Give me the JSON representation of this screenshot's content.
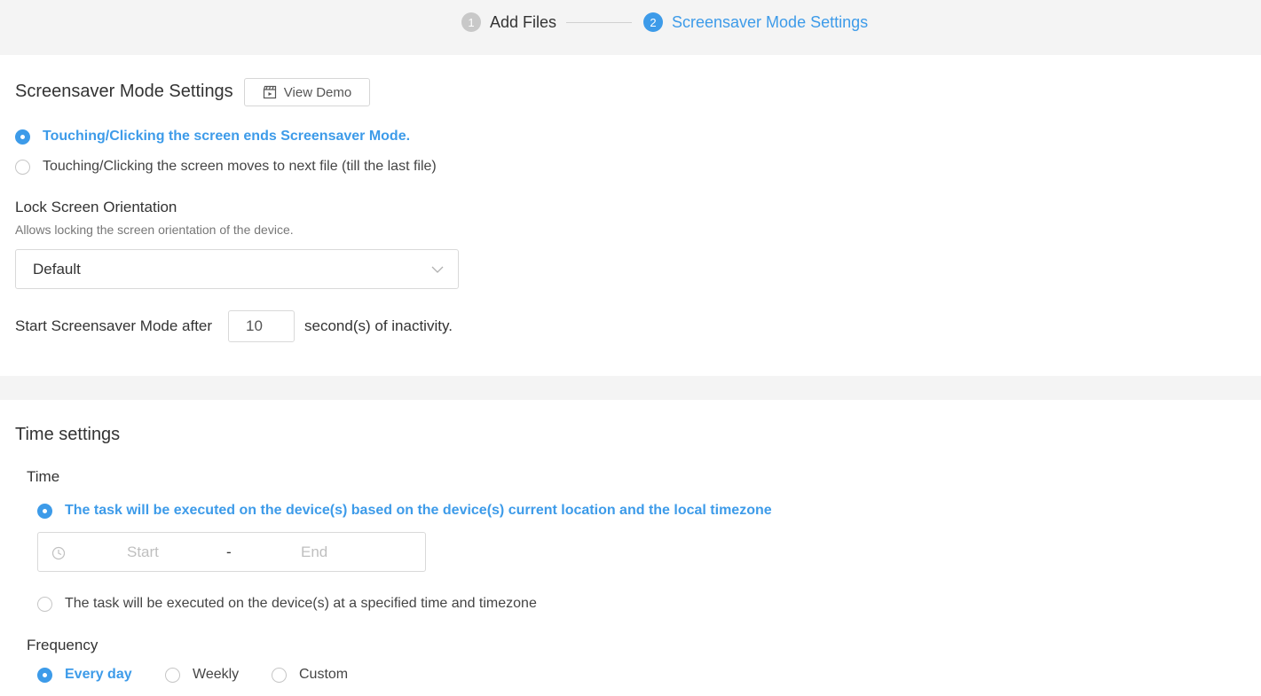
{
  "steps": [
    {
      "num": "1",
      "label": "Add Files"
    },
    {
      "num": "2",
      "label": "Screensaver Mode Settings"
    }
  ],
  "colors": {
    "accent": "#3d9be9",
    "band": "#f4f4f4"
  },
  "screensaver": {
    "title": "Screensaver Mode Settings",
    "demo_button": "View Demo",
    "demo_icon": "clapperboard-icon",
    "options": [
      {
        "label": "Touching/Clicking the screen ends Screensaver Mode.",
        "selected": true
      },
      {
        "label": "Touching/Clicking the screen moves to next file (till the last file)",
        "selected": false
      }
    ]
  },
  "orientation": {
    "label": "Lock Screen Orientation",
    "hint": "Allows locking the screen orientation of the device.",
    "value": "Default"
  },
  "inactivity": {
    "prefix": "Start Screensaver Mode after",
    "value": "10",
    "suffix": "second(s) of inactivity."
  },
  "time_settings": {
    "title": "Time settings",
    "time_label": "Time",
    "options": [
      {
        "label": "The task will be executed on the device(s) based on the device(s) current location and the local timezone",
        "selected": true
      },
      {
        "label": "The task will be executed on the device(s) at a specified time and timezone",
        "selected": false
      }
    ],
    "range": {
      "start_placeholder": "Start",
      "separator": "-",
      "end_placeholder": "End"
    },
    "frequency_label": "Frequency",
    "frequency": [
      {
        "label": "Every day",
        "selected": true
      },
      {
        "label": "Weekly",
        "selected": false
      },
      {
        "label": "Custom",
        "selected": false
      }
    ]
  }
}
